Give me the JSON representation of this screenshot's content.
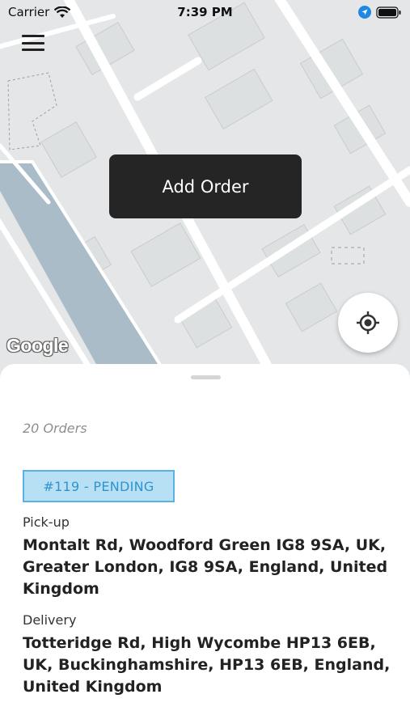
{
  "status_bar": {
    "carrier": "Carrier",
    "time": "7:39 PM"
  },
  "map": {
    "provider_logo": "Google",
    "add_order_label": "Add Order",
    "icons": [
      "menu-icon",
      "locate-icon"
    ]
  },
  "sheet": {
    "orders_count": "20 Orders",
    "order": {
      "badge": "#119 - PENDING",
      "pickup_label": "Pick-up",
      "pickup_address": "Montalt Rd, Woodford Green IG8 9SA, UK, Greater London, IG8 9SA, England, United Kingdom",
      "delivery_label": "Delivery",
      "delivery_address": "Totteridge Rd, High Wycombe HP13 6EB, UK, Buckinghamshire, HP13 6EB, England, United Kingdom"
    }
  },
  "colors": {
    "button_dark": "#252525",
    "badge_bg": "#b8e0f5",
    "badge_border": "#5ab2e3",
    "badge_text": "#2e93cf",
    "map_bg": "#e4e6e7",
    "water": "#aabcc8"
  }
}
